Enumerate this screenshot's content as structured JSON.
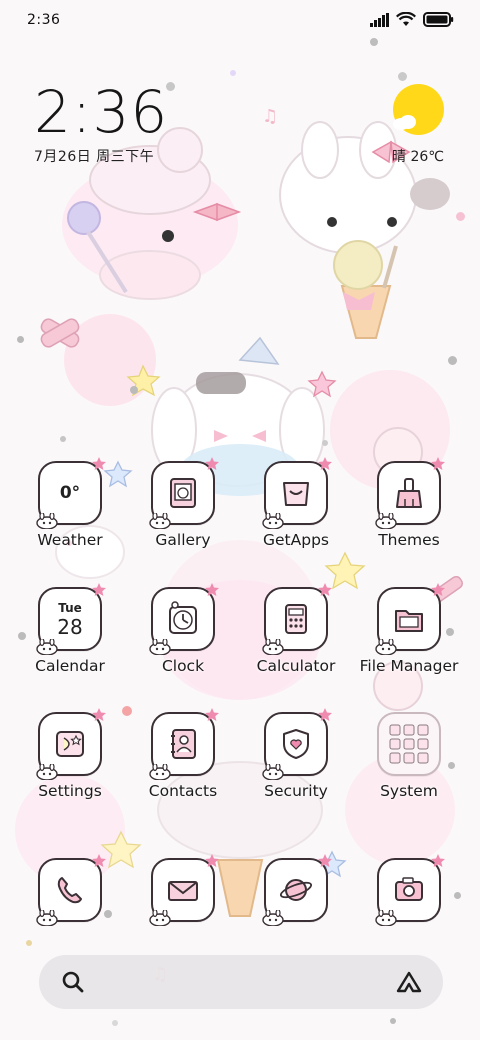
{
  "status_bar": {
    "time": "2:36",
    "icons": [
      "signal-icon",
      "wifi-icon",
      "battery-icon"
    ]
  },
  "clock_widget": {
    "time": "2:36",
    "date": "7月26日 周三下午"
  },
  "weather_widget": {
    "condition_icon": "sunny-cloud-icon",
    "text": "晴 26℃"
  },
  "apps": [
    {
      "id": "weather",
      "label": "Weather",
      "icon": "weather-icon",
      "glyph_text": "0°"
    },
    {
      "id": "gallery",
      "label": "Gallery",
      "icon": "gallery-icon"
    },
    {
      "id": "getapps",
      "label": "GetApps",
      "icon": "getapps-icon"
    },
    {
      "id": "themes",
      "label": "Themes",
      "icon": "themes-icon"
    },
    {
      "id": "calendar",
      "label": "Calendar",
      "icon": "calendar-icon",
      "day": "Tue",
      "date": "28"
    },
    {
      "id": "clock",
      "label": "Clock",
      "icon": "clock-icon"
    },
    {
      "id": "calculator",
      "label": "Calculator",
      "icon": "calculator-icon"
    },
    {
      "id": "file_manager",
      "label": "File Manager",
      "icon": "file-manager-icon"
    },
    {
      "id": "settings",
      "label": "Settings",
      "icon": "settings-icon"
    },
    {
      "id": "contacts",
      "label": "Contacts",
      "icon": "contacts-icon"
    },
    {
      "id": "security",
      "label": "Security",
      "icon": "security-icon"
    },
    {
      "id": "system",
      "label": "System",
      "icon": "system-folder-icon"
    }
  ],
  "dock": [
    {
      "id": "phone",
      "icon": "phone-icon"
    },
    {
      "id": "messages",
      "icon": "messages-icon"
    },
    {
      "id": "browser",
      "icon": "browser-icon"
    },
    {
      "id": "camera",
      "icon": "camera-icon"
    }
  ],
  "search_bar": {
    "left_icon": "search-icon",
    "right_icon": "assistant-icon"
  },
  "colors": {
    "sun": "#ffd81a",
    "accent_pink": "#f08bb0",
    "icon_outline": "#3a3036"
  }
}
